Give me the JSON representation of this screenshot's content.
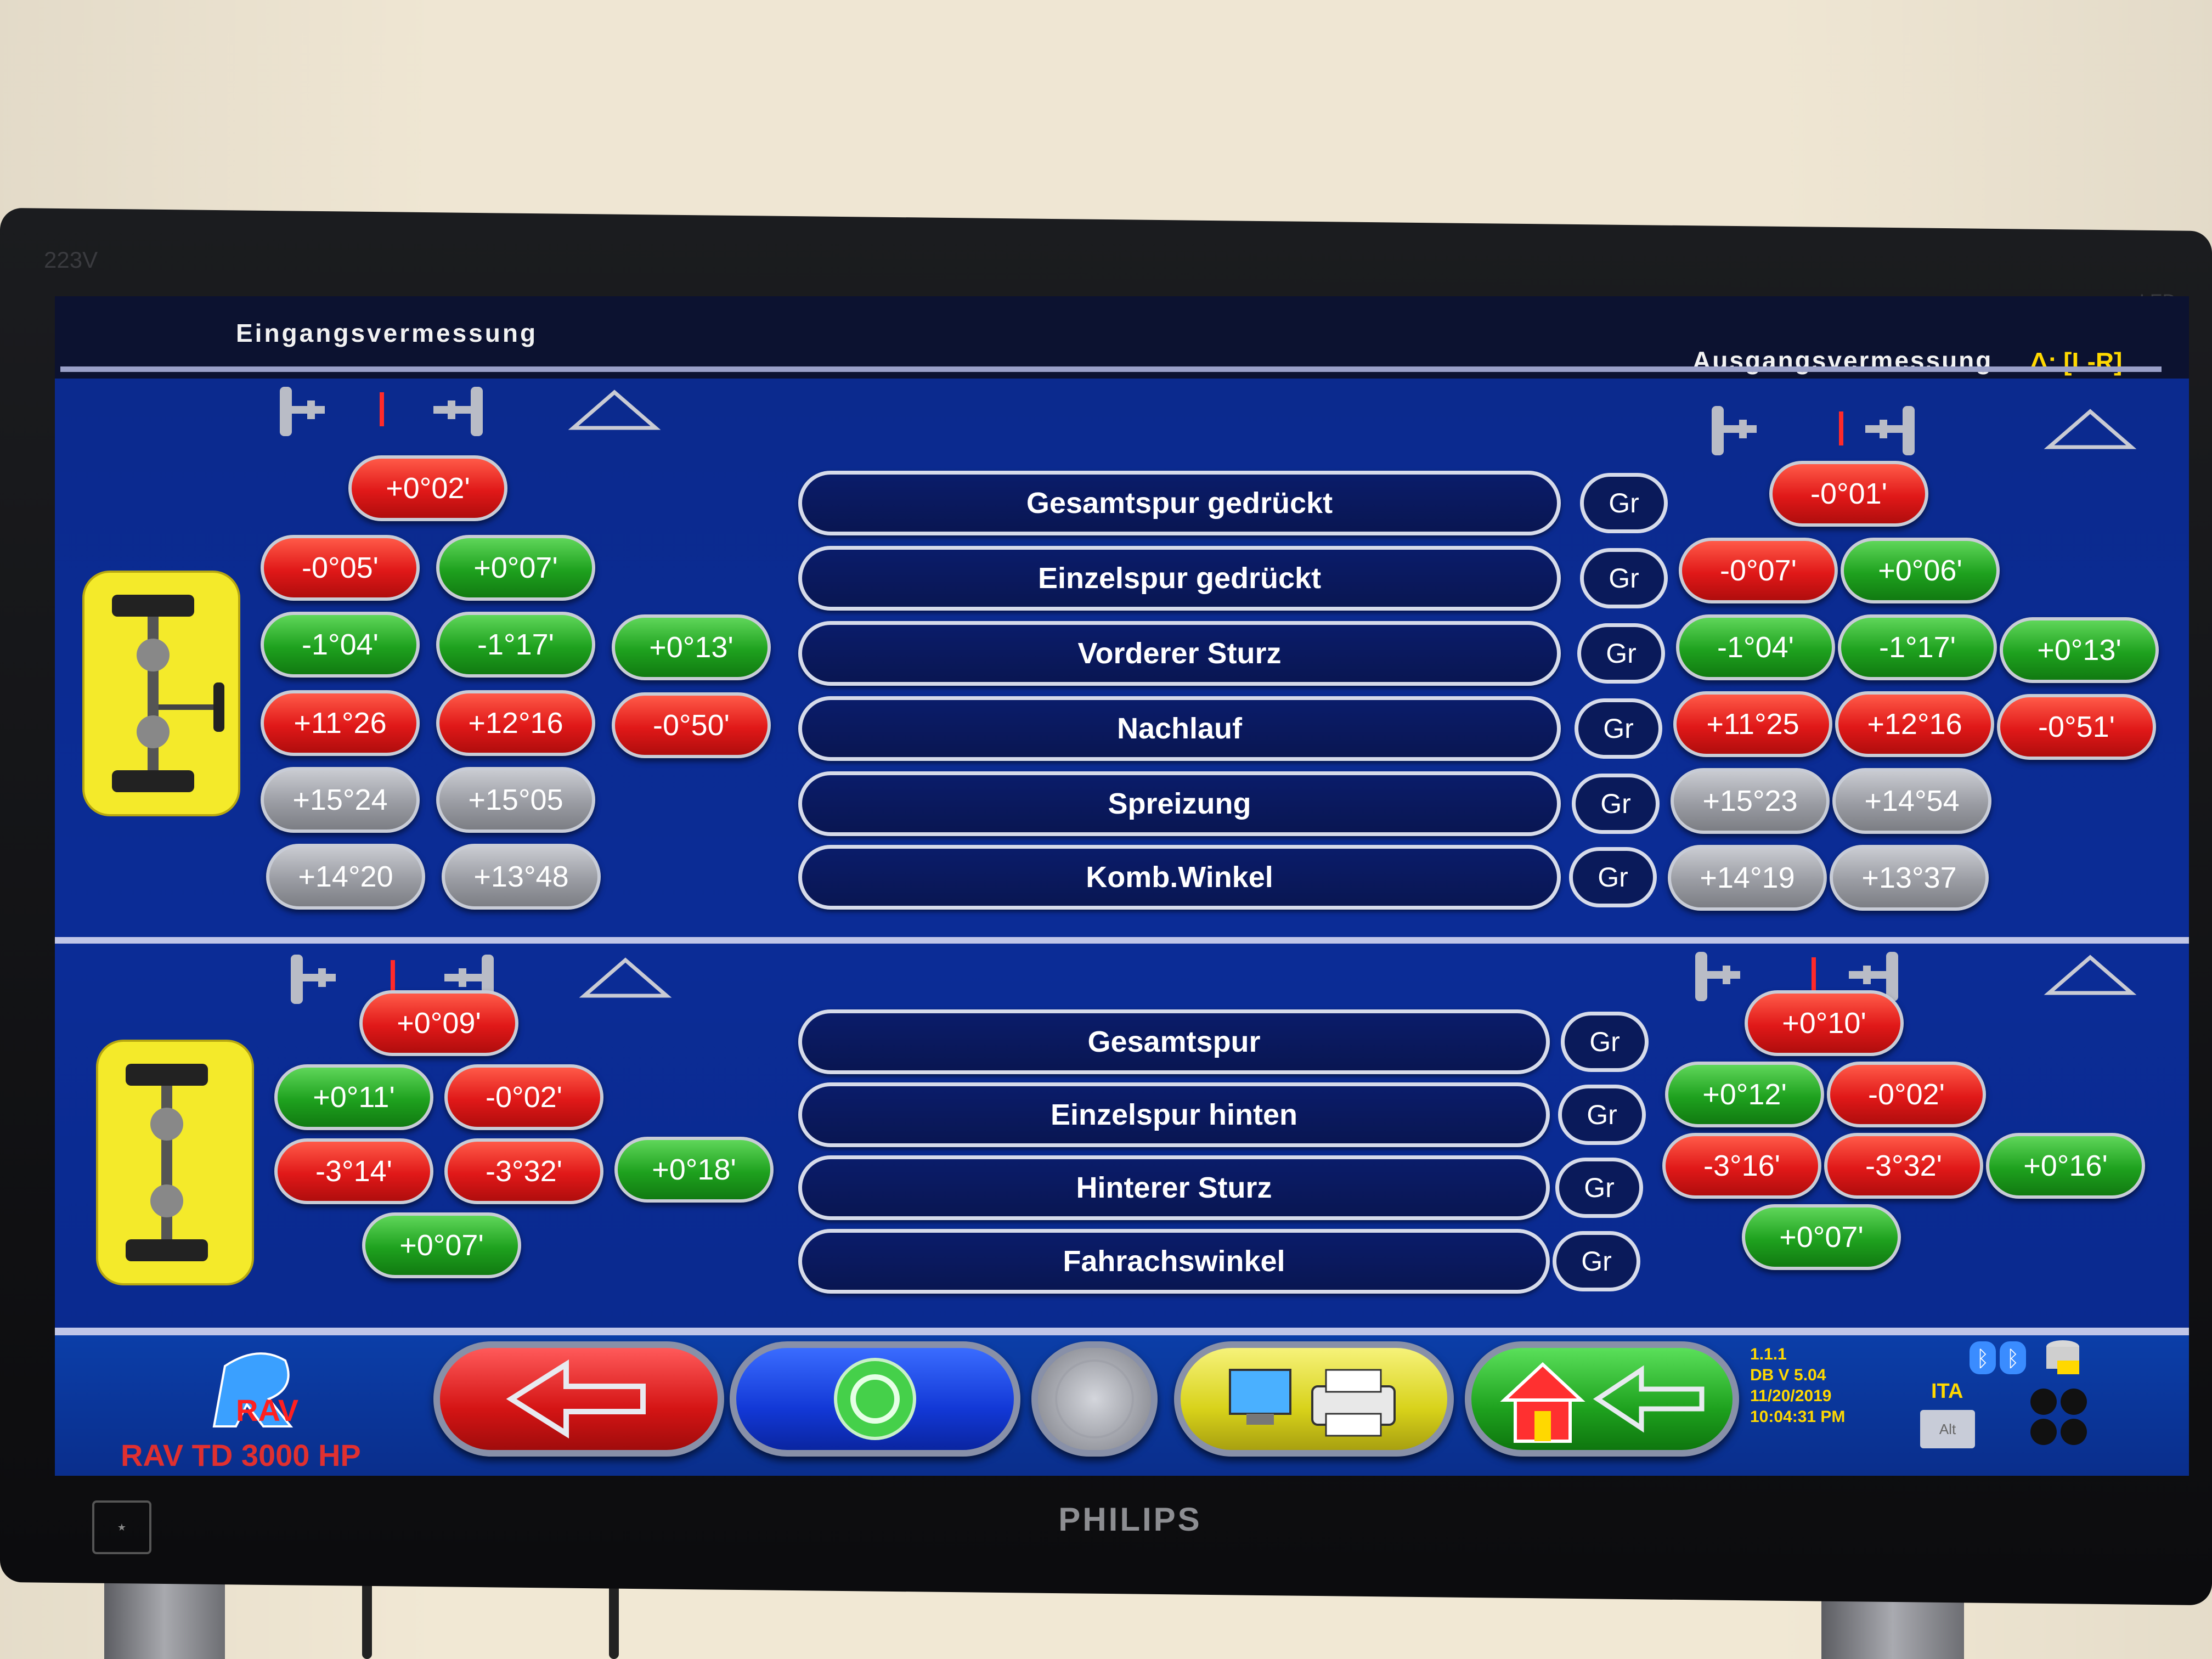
{
  "monitor": {
    "brand": "PHILIPS",
    "model": "223V",
    "led": "LED"
  },
  "header": {
    "left_title": "Eingangsvermessung",
    "right_title": "Ausgangsvermessung",
    "delta_label": "Δ: [L-R]"
  },
  "front": {
    "rows": [
      {
        "label": "Gesamtspur gedrückt",
        "gr": "Gr",
        "left": [
          {
            "v": "+0°02'",
            "c": "red"
          }
        ],
        "right": [
          {
            "v": "-0°01'",
            "c": "red"
          }
        ]
      },
      {
        "label": "Einzelspur gedrückt",
        "gr": "Gr",
        "left": [
          {
            "v": "-0°05'",
            "c": "red"
          },
          {
            "v": "+0°07'",
            "c": "green"
          }
        ],
        "right": [
          {
            "v": "-0°07'",
            "c": "red"
          },
          {
            "v": "+0°06'",
            "c": "green"
          }
        ]
      },
      {
        "label": "Vorderer Sturz",
        "gr": "Gr",
        "left": [
          {
            "v": "-1°04'",
            "c": "green"
          },
          {
            "v": "-1°17'",
            "c": "green"
          },
          {
            "v": "+0°13'",
            "c": "green"
          }
        ],
        "right": [
          {
            "v": "-1°04'",
            "c": "green"
          },
          {
            "v": "-1°17'",
            "c": "green"
          },
          {
            "v": "+0°13'",
            "c": "green"
          }
        ]
      },
      {
        "label": "Nachlauf",
        "gr": "Gr",
        "left": [
          {
            "v": "+11°26",
            "c": "red"
          },
          {
            "v": "+12°16",
            "c": "red"
          },
          {
            "v": "-0°50'",
            "c": "red"
          }
        ],
        "right": [
          {
            "v": "+11°25",
            "c": "red"
          },
          {
            "v": "+12°16",
            "c": "red"
          },
          {
            "v": "-0°51'",
            "c": "red"
          }
        ]
      },
      {
        "label": "Spreizung",
        "gr": "Gr",
        "left": [
          {
            "v": "+15°24",
            "c": "gray"
          },
          {
            "v": "+15°05",
            "c": "gray"
          }
        ],
        "right": [
          {
            "v": "+15°23",
            "c": "gray"
          },
          {
            "v": "+14°54",
            "c": "gray"
          }
        ]
      },
      {
        "label": "Komb.Winkel",
        "gr": "Gr",
        "left": [
          {
            "v": "+14°20",
            "c": "gray"
          },
          {
            "v": "+13°48",
            "c": "gray"
          }
        ],
        "right": [
          {
            "v": "+14°19",
            "c": "gray"
          },
          {
            "v": "+13°37",
            "c": "gray"
          }
        ]
      }
    ]
  },
  "rear": {
    "rows": [
      {
        "label": "Gesamtspur",
        "gr": "Gr",
        "left": [
          {
            "v": "+0°09'",
            "c": "red"
          }
        ],
        "right": [
          {
            "v": "+0°10'",
            "c": "red"
          }
        ]
      },
      {
        "label": "Einzelspur hinten",
        "gr": "Gr",
        "left": [
          {
            "v": "+0°11'",
            "c": "green"
          },
          {
            "v": "-0°02'",
            "c": "red"
          }
        ],
        "right": [
          {
            "v": "+0°12'",
            "c": "green"
          },
          {
            "v": "-0°02'",
            "c": "red"
          }
        ]
      },
      {
        "label": "Hinterer Sturz",
        "gr": "Gr",
        "left": [
          {
            "v": "-3°14'",
            "c": "red"
          },
          {
            "v": "-3°32'",
            "c": "red"
          },
          {
            "v": "+0°18'",
            "c": "green"
          }
        ],
        "right": [
          {
            "v": "-3°16'",
            "c": "red"
          },
          {
            "v": "-3°32'",
            "c": "red"
          },
          {
            "v": "+0°16'",
            "c": "green"
          }
        ]
      },
      {
        "label": "Fahrachswinkel",
        "gr": "Gr",
        "left": [
          {
            "v": "+0°07'",
            "c": "green"
          }
        ],
        "right": [
          {
            "v": "+0°07'",
            "c": "green"
          }
        ]
      }
    ]
  },
  "footer": {
    "logo": "RAV",
    "product": "RAV TD 3000 HP",
    "version": "1.1.1",
    "db": "DB V 5.04",
    "date": "11/20/2019",
    "time": "10:04:31 PM",
    "lang": "ITA",
    "alt": "Alt",
    "buttons": [
      "back-arrow-icon",
      "refresh-icon",
      "blank-circle-icon",
      "print-icon",
      "home-back-icon"
    ]
  },
  "colors": {
    "red": "#e01818",
    "green": "#1ea11e",
    "gray": "#9a9ca3",
    "panel": "#0b2c96",
    "accent": "#ffd800"
  }
}
